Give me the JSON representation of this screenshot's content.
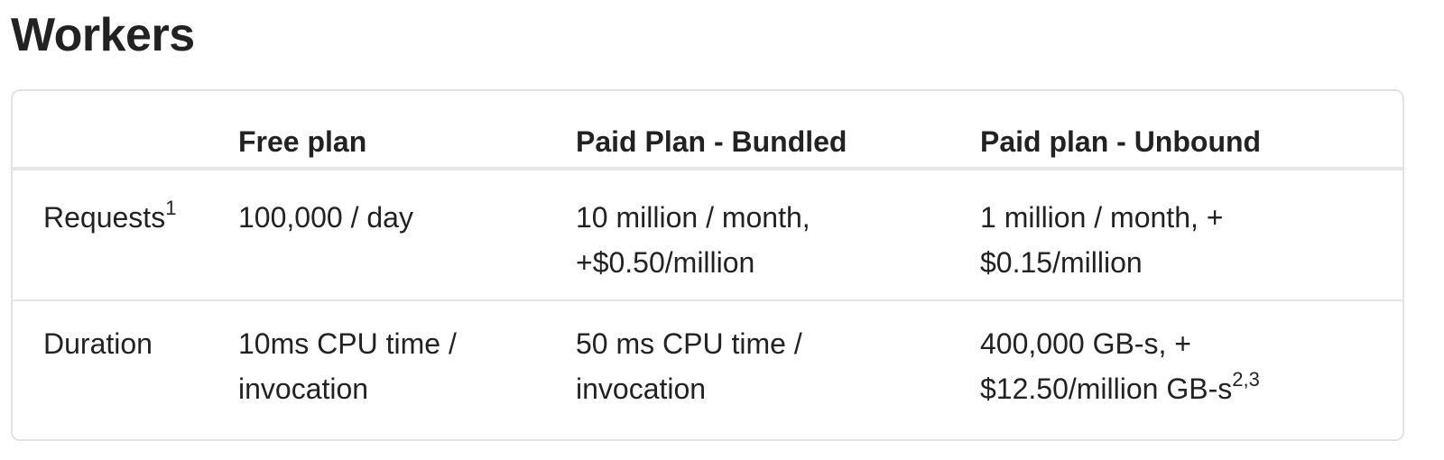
{
  "page": {
    "title": "Workers"
  },
  "table": {
    "headers": [
      "",
      "Free plan",
      "Paid Plan - Bundled",
      "Paid plan - Unbound"
    ],
    "rows": [
      {
        "label": "Requests",
        "label_sup": "1",
        "free": "100,000 / day",
        "bundled_line1": "10 million / month,",
        "bundled_line2": "+$0.50/million",
        "unbound_line1": "1 million / month, +",
        "unbound_line2": "$0.15/million",
        "unbound_sup": ""
      },
      {
        "label": "Duration",
        "label_sup": "",
        "free_line1": "10ms CPU time /",
        "free_line2": "invocation",
        "bundled_line1": "50 ms CPU time /",
        "bundled_line2": "invocation",
        "unbound_line1": "400,000 GB-s, +",
        "unbound_line2": "$12.50/million GB-s",
        "unbound_sup": "2,3"
      }
    ]
  },
  "colors": {
    "text": "#222222",
    "border": "#e2e2e2",
    "background": "#ffffff"
  }
}
